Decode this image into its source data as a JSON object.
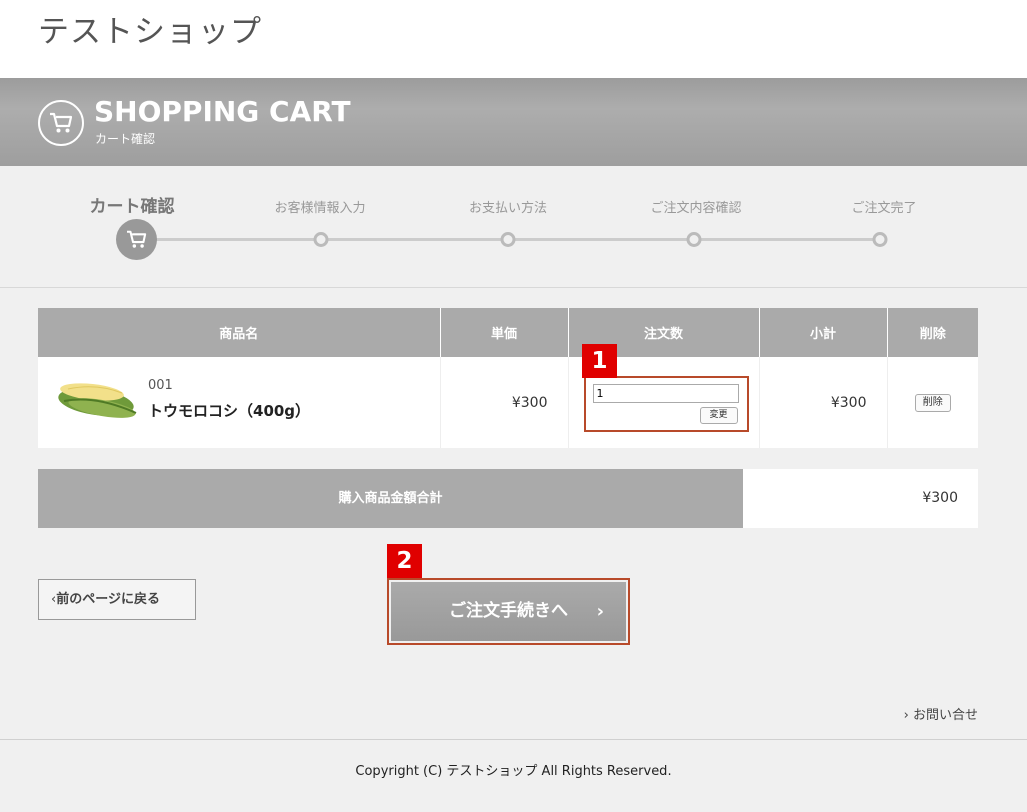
{
  "header": {
    "site_title": "テストショップ"
  },
  "banner": {
    "title": "SHOPPING CART",
    "subtitle": "カート確認"
  },
  "steps": [
    {
      "label": "カート確認",
      "active": true
    },
    {
      "label": "お客様情報入力",
      "active": false
    },
    {
      "label": "お支払い方法",
      "active": false
    },
    {
      "label": "ご注文内容確認",
      "active": false
    },
    {
      "label": "ご注文完了",
      "active": false
    }
  ],
  "table": {
    "headers": [
      "商品名",
      "単価",
      "注文数",
      "小計",
      "削除"
    ],
    "rows": [
      {
        "code": "001",
        "name": "トウモロコシ（400g）",
        "price": "¥300",
        "quantity": "1",
        "change_label": "変更",
        "subtotal": "¥300",
        "delete_label": "削除"
      }
    ]
  },
  "total": {
    "label": "購入商品金額合計",
    "value": "¥300"
  },
  "badges": {
    "first": "1",
    "second": "2"
  },
  "buttons": {
    "back_label": "前のページに戻る",
    "checkout_label": "ご注文手続きへ"
  },
  "footer": {
    "contact_label": "お問い合せ",
    "copyright": "Copyright (C) テストショップ All Rights Reserved."
  },
  "colors": {
    "accent_border": "#b84a2a",
    "badge": "#e00000",
    "banner": "#a6a6a6"
  }
}
